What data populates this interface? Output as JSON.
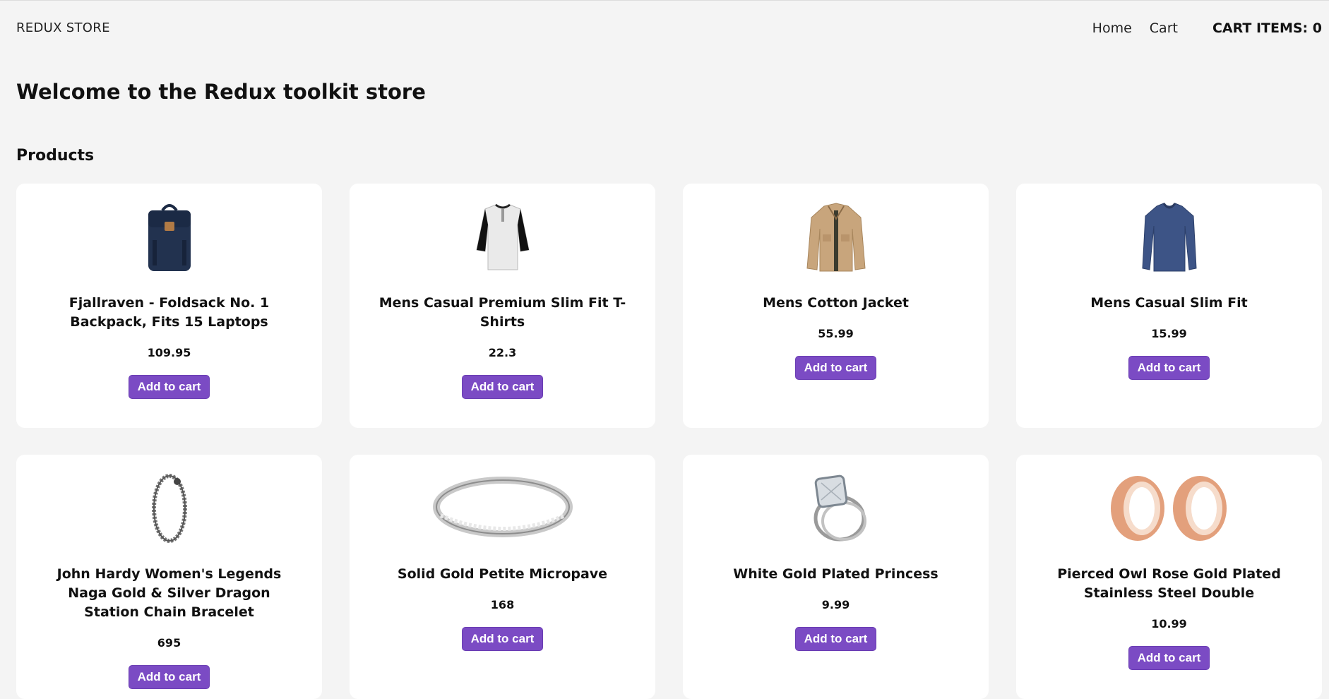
{
  "header": {
    "brand": "REDUX STORE",
    "nav": [
      {
        "label": "Home"
      },
      {
        "label": "Cart"
      }
    ],
    "cart_items": "CART ITEMS: 0"
  },
  "main": {
    "welcome": "Welcome to the Redux toolkit store",
    "section_title": "Products",
    "add_label": "Add to cart",
    "products": [
      {
        "name": "Fjallraven - Foldsack No. 1 Backpack, Fits 15 Laptops",
        "price": "109.95",
        "icon": "backpack-icon"
      },
      {
        "name": "Mens Casual Premium Slim Fit T-Shirts",
        "price": "22.3",
        "icon": "tshirt-icon"
      },
      {
        "name": "Mens Cotton Jacket",
        "price": "55.99",
        "icon": "jacket-icon"
      },
      {
        "name": "Mens Casual Slim Fit",
        "price": "15.99",
        "icon": "sweater-icon"
      },
      {
        "name": "John Hardy Women's Legends Naga Gold & Silver Dragon Station Chain Bracelet",
        "price": "695",
        "icon": "bracelet-icon"
      },
      {
        "name": "Solid Gold Petite Micropave",
        "price": "168",
        "icon": "ring-band-icon"
      },
      {
        "name": "White Gold Plated Princess",
        "price": "9.99",
        "icon": "diamond-ring-icon"
      },
      {
        "name": "Pierced Owl Rose Gold Plated Stainless Steel Double",
        "price": "10.99",
        "icon": "ear-plugs-icon"
      }
    ]
  },
  "colors": {
    "button": "#7b4bc4",
    "background": "#f4f4f4",
    "card": "#ffffff"
  }
}
